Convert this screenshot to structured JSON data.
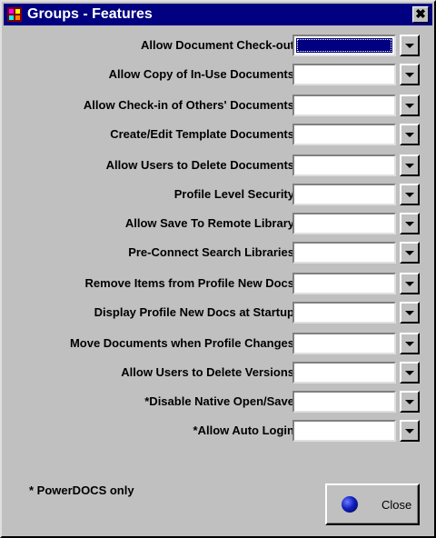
{
  "window": {
    "title": "Groups - Features",
    "close_glyph": "✖"
  },
  "rows": [
    {
      "label": "Allow Document Check-out",
      "value": ""
    },
    {
      "label": "Allow Copy of In-Use Documents",
      "value": ""
    },
    {
      "label": "Allow Check-in of Others' Documents",
      "value": ""
    },
    {
      "label": "Create/Edit Template Documents",
      "value": ""
    },
    {
      "label": "Allow Users to Delete Documents",
      "value": ""
    },
    {
      "label": "Profile Level Security",
      "value": ""
    },
    {
      "label": "Allow Save To Remote Library",
      "value": ""
    },
    {
      "label": "Pre-Connect Search Libraries",
      "value": ""
    },
    {
      "label": "Remove Items from Profile New Docs",
      "value": ""
    },
    {
      "label": "Display Profile New Docs at Startup",
      "value": ""
    },
    {
      "label": "Move Documents when Profile Changes",
      "value": ""
    },
    {
      "label": "Allow Users to Delete Versions",
      "value": ""
    },
    {
      "label": "*Disable Native Open/Save",
      "value": ""
    },
    {
      "label": "*Allow Auto Login",
      "value": ""
    }
  ],
  "footnote": "* PowerDOCS only",
  "buttons": {
    "close_label": "Close"
  },
  "icons": {
    "app": "app-icon",
    "button": "blue-ball-icon"
  },
  "colors": {
    "titlebar": "#000080",
    "face": "#c0c0c0"
  }
}
